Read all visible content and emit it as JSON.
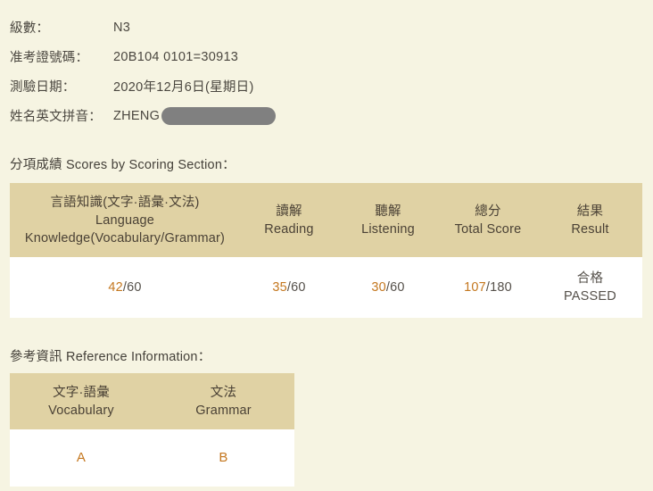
{
  "info": {
    "rows": [
      {
        "label": "級數：",
        "value": "N3"
      },
      {
        "label": "准考證號碼：",
        "value": "20B104 0101=30913"
      },
      {
        "label": "測驗日期：",
        "value": "2020年12月6日(星期日)"
      },
      {
        "label": "姓名英文拼音：",
        "value": "ZHENG"
      }
    ]
  },
  "scores_section": {
    "caption": "分項成績 Scores by Scoring Section：",
    "headers": [
      {
        "cjk": "言語知識(文字·語彙·文法)",
        "en_line1": "Language",
        "en_line2": "Knowledge(Vocabulary/Grammar)"
      },
      {
        "cjk": "讀解",
        "en_line1": "Reading",
        "en_line2": ""
      },
      {
        "cjk": "聽解",
        "en_line1": "Listening",
        "en_line2": ""
      },
      {
        "cjk": "總分",
        "en_line1": "Total Score",
        "en_line2": ""
      },
      {
        "cjk": "結果",
        "en_line1": "Result",
        "en_line2": ""
      }
    ],
    "values": {
      "language_knowledge": {
        "score": "42",
        "max": "/60"
      },
      "reading": {
        "score": "35",
        "max": "/60"
      },
      "listening": {
        "score": "30",
        "max": "/60"
      },
      "total": {
        "score": "107",
        "max": "/180"
      },
      "result": {
        "cjk": "合格",
        "en": "PASSED"
      }
    }
  },
  "reference_section": {
    "caption": "參考資訊 Reference Information：",
    "headers": [
      {
        "cjk": "文字·語彙",
        "en": "Vocabulary"
      },
      {
        "cjk": "文法",
        "en": "Grammar"
      }
    ],
    "values": {
      "vocabulary": "A",
      "grammar": "B"
    }
  },
  "colors": {
    "page_background": "#f6f4e2",
    "table_header": "#e0d2a4",
    "accent_orange": "#c4771f",
    "text": "#45413a",
    "redaction": "#808080"
  }
}
